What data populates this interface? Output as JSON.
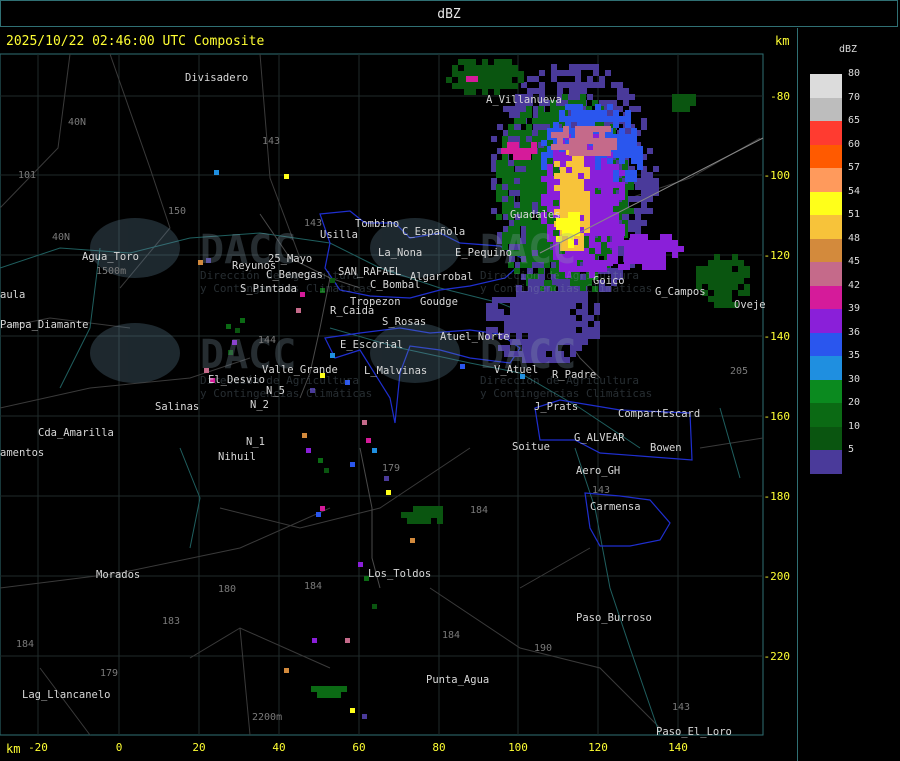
{
  "header": {
    "title": "dBZ",
    "timestamp": "2025/10/22 02:46:00 UTC Composite",
    "km_top": "km",
    "km_bottom": "km"
  },
  "legend": {
    "title": "dBZ",
    "entries": [
      {
        "label": "80",
        "color": "#dcdcdc"
      },
      {
        "label": "70",
        "color": "#bdbdbd"
      },
      {
        "label": "65",
        "color": "#ff3b30"
      },
      {
        "label": "60",
        "color": "#ff5a00"
      },
      {
        "label": "57",
        "color": "#ff9a5c"
      },
      {
        "label": "54",
        "color": "#ffff1a"
      },
      {
        "label": "51",
        "color": "#f7c33a"
      },
      {
        "label": "48",
        "color": "#d38a3c"
      },
      {
        "label": "45",
        "color": "#c56a8a"
      },
      {
        "label": "42",
        "color": "#d51b9a"
      },
      {
        "label": "39",
        "color": "#8a1fd9"
      },
      {
        "label": "36",
        "color": "#2a56ee"
      },
      {
        "label": "35",
        "color": "#1f8fe0"
      },
      {
        "label": "30",
        "color": "#0b8a1f"
      },
      {
        "label": "20",
        "color": "#0b6a14"
      },
      {
        "label": "10",
        "color": "#0a5510"
      },
      {
        "label": "5",
        "color": "#4a3a9a"
      }
    ]
  },
  "axes": {
    "x_ticks": [
      "-20",
      "0",
      "20",
      "40",
      "60",
      "80",
      "100",
      "120",
      "140"
    ],
    "y_ticks": [
      "-80",
      "-100",
      "-120",
      "-140",
      "-160",
      "-180",
      "-200",
      "-220"
    ]
  },
  "places": [
    "Divisadero",
    "A_Villanueva",
    "Tombino",
    "Usilla",
    "C_Española",
    "Agua_Toro",
    "La_Nona",
    "E_Pequino",
    "Reyunos",
    "25_Mayo",
    "C_Benegas",
    "SAN_RAFAEL",
    "Algarrobal",
    "C_Bombal",
    "S_Pintada",
    "Tropezon",
    "Goudge",
    "R_Caida",
    "S_Rosas",
    "Atuel_Norte",
    "E_Escorial",
    "Guadales",
    "Pampa_Diamante",
    "aula",
    "Valle_Grande",
    "L_Malvinas",
    "V_Atuel",
    "R_Padre",
    "El_Desvio",
    "Salinas",
    "N_2",
    "N_5",
    "J_Prats",
    "CompartEscard",
    "Cda_Amarilla",
    "amentos",
    "N_1",
    "Nihuil",
    "G_ALVEAR",
    "Soitue",
    "Bowen",
    "Aero_GH",
    "Carmensa",
    "Morados",
    "Los_Toldos",
    "Paso_Burroso",
    "Lag_Llancanelo",
    "Punta_Agua",
    "Paso_El_Loro",
    "Oveje",
    "G_Campos",
    "Goico"
  ],
  "route_labels": [
    "40N",
    "143",
    "101",
    "150",
    "40N",
    "143",
    "144",
    "179",
    "184",
    "180",
    "184",
    "183",
    "179",
    "184",
    "190",
    "143",
    "205",
    "184",
    "143"
  ],
  "elev_labels": [
    "1500m",
    "2200m"
  ],
  "watermark": {
    "brand": "DACC",
    "line1": "Dirección de Agricultura",
    "line2": "y Contingencias Climáticas"
  }
}
